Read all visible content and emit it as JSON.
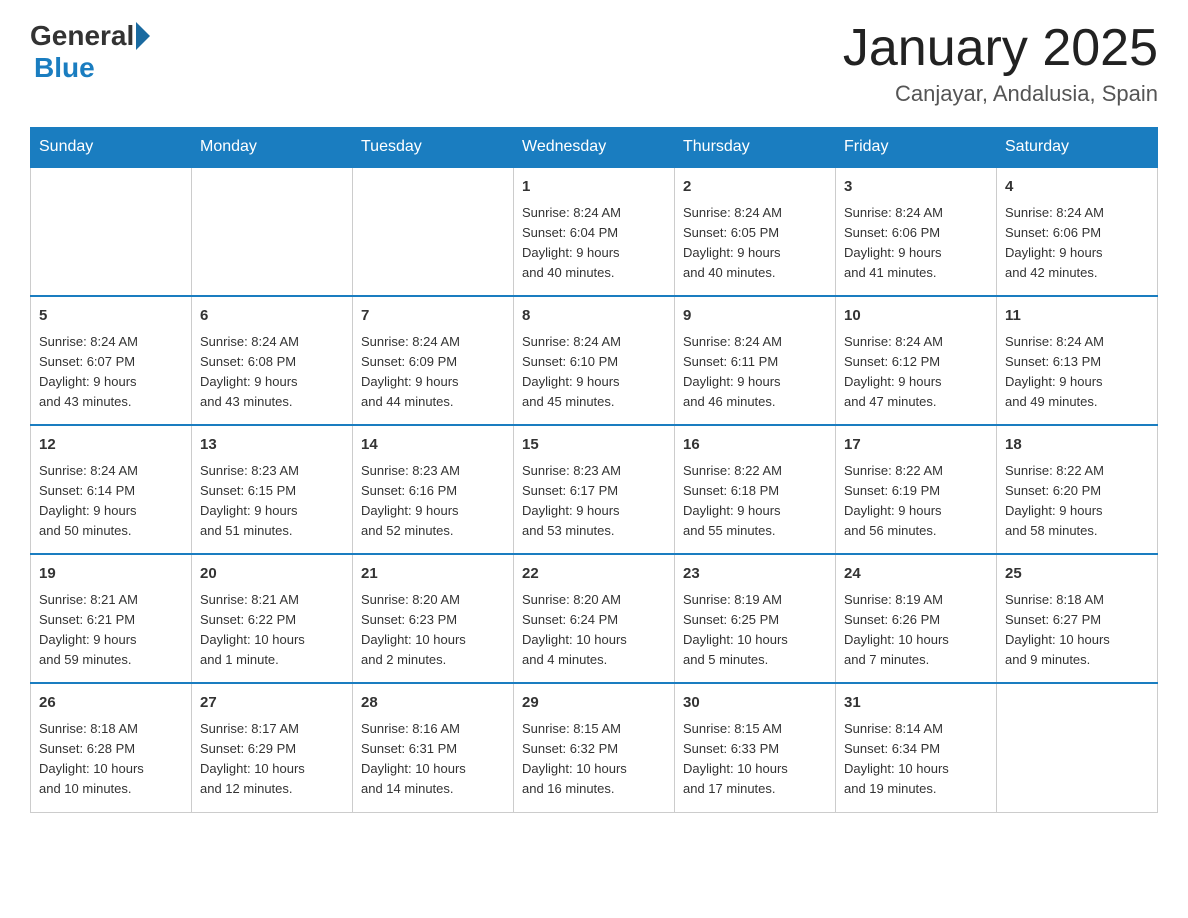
{
  "logo": {
    "general": "General",
    "blue": "Blue"
  },
  "title": "January 2025",
  "subtitle": "Canjayar, Andalusia, Spain",
  "headers": [
    "Sunday",
    "Monday",
    "Tuesday",
    "Wednesday",
    "Thursday",
    "Friday",
    "Saturday"
  ],
  "weeks": [
    [
      {
        "day": "",
        "info": ""
      },
      {
        "day": "",
        "info": ""
      },
      {
        "day": "",
        "info": ""
      },
      {
        "day": "1",
        "info": "Sunrise: 8:24 AM\nSunset: 6:04 PM\nDaylight: 9 hours\nand 40 minutes."
      },
      {
        "day": "2",
        "info": "Sunrise: 8:24 AM\nSunset: 6:05 PM\nDaylight: 9 hours\nand 40 minutes."
      },
      {
        "day": "3",
        "info": "Sunrise: 8:24 AM\nSunset: 6:06 PM\nDaylight: 9 hours\nand 41 minutes."
      },
      {
        "day": "4",
        "info": "Sunrise: 8:24 AM\nSunset: 6:06 PM\nDaylight: 9 hours\nand 42 minutes."
      }
    ],
    [
      {
        "day": "5",
        "info": "Sunrise: 8:24 AM\nSunset: 6:07 PM\nDaylight: 9 hours\nand 43 minutes."
      },
      {
        "day": "6",
        "info": "Sunrise: 8:24 AM\nSunset: 6:08 PM\nDaylight: 9 hours\nand 43 minutes."
      },
      {
        "day": "7",
        "info": "Sunrise: 8:24 AM\nSunset: 6:09 PM\nDaylight: 9 hours\nand 44 minutes."
      },
      {
        "day": "8",
        "info": "Sunrise: 8:24 AM\nSunset: 6:10 PM\nDaylight: 9 hours\nand 45 minutes."
      },
      {
        "day": "9",
        "info": "Sunrise: 8:24 AM\nSunset: 6:11 PM\nDaylight: 9 hours\nand 46 minutes."
      },
      {
        "day": "10",
        "info": "Sunrise: 8:24 AM\nSunset: 6:12 PM\nDaylight: 9 hours\nand 47 minutes."
      },
      {
        "day": "11",
        "info": "Sunrise: 8:24 AM\nSunset: 6:13 PM\nDaylight: 9 hours\nand 49 minutes."
      }
    ],
    [
      {
        "day": "12",
        "info": "Sunrise: 8:24 AM\nSunset: 6:14 PM\nDaylight: 9 hours\nand 50 minutes."
      },
      {
        "day": "13",
        "info": "Sunrise: 8:23 AM\nSunset: 6:15 PM\nDaylight: 9 hours\nand 51 minutes."
      },
      {
        "day": "14",
        "info": "Sunrise: 8:23 AM\nSunset: 6:16 PM\nDaylight: 9 hours\nand 52 minutes."
      },
      {
        "day": "15",
        "info": "Sunrise: 8:23 AM\nSunset: 6:17 PM\nDaylight: 9 hours\nand 53 minutes."
      },
      {
        "day": "16",
        "info": "Sunrise: 8:22 AM\nSunset: 6:18 PM\nDaylight: 9 hours\nand 55 minutes."
      },
      {
        "day": "17",
        "info": "Sunrise: 8:22 AM\nSunset: 6:19 PM\nDaylight: 9 hours\nand 56 minutes."
      },
      {
        "day": "18",
        "info": "Sunrise: 8:22 AM\nSunset: 6:20 PM\nDaylight: 9 hours\nand 58 minutes."
      }
    ],
    [
      {
        "day": "19",
        "info": "Sunrise: 8:21 AM\nSunset: 6:21 PM\nDaylight: 9 hours\nand 59 minutes."
      },
      {
        "day": "20",
        "info": "Sunrise: 8:21 AM\nSunset: 6:22 PM\nDaylight: 10 hours\nand 1 minute."
      },
      {
        "day": "21",
        "info": "Sunrise: 8:20 AM\nSunset: 6:23 PM\nDaylight: 10 hours\nand 2 minutes."
      },
      {
        "day": "22",
        "info": "Sunrise: 8:20 AM\nSunset: 6:24 PM\nDaylight: 10 hours\nand 4 minutes."
      },
      {
        "day": "23",
        "info": "Sunrise: 8:19 AM\nSunset: 6:25 PM\nDaylight: 10 hours\nand 5 minutes."
      },
      {
        "day": "24",
        "info": "Sunrise: 8:19 AM\nSunset: 6:26 PM\nDaylight: 10 hours\nand 7 minutes."
      },
      {
        "day": "25",
        "info": "Sunrise: 8:18 AM\nSunset: 6:27 PM\nDaylight: 10 hours\nand 9 minutes."
      }
    ],
    [
      {
        "day": "26",
        "info": "Sunrise: 8:18 AM\nSunset: 6:28 PM\nDaylight: 10 hours\nand 10 minutes."
      },
      {
        "day": "27",
        "info": "Sunrise: 8:17 AM\nSunset: 6:29 PM\nDaylight: 10 hours\nand 12 minutes."
      },
      {
        "day": "28",
        "info": "Sunrise: 8:16 AM\nSunset: 6:31 PM\nDaylight: 10 hours\nand 14 minutes."
      },
      {
        "day": "29",
        "info": "Sunrise: 8:15 AM\nSunset: 6:32 PM\nDaylight: 10 hours\nand 16 minutes."
      },
      {
        "day": "30",
        "info": "Sunrise: 8:15 AM\nSunset: 6:33 PM\nDaylight: 10 hours\nand 17 minutes."
      },
      {
        "day": "31",
        "info": "Sunrise: 8:14 AM\nSunset: 6:34 PM\nDaylight: 10 hours\nand 19 minutes."
      },
      {
        "day": "",
        "info": ""
      }
    ]
  ]
}
